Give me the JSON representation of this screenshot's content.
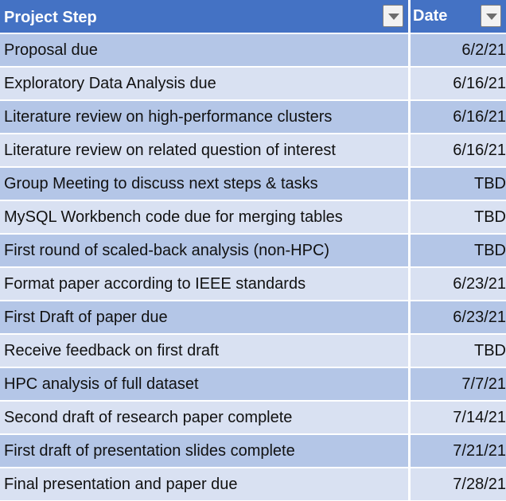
{
  "header": {
    "step_label": "Project Step",
    "date_label": "Date",
    "filter_icon": "filter-dropdown-arrow-icon"
  },
  "rows": [
    {
      "step": "Proposal due",
      "date": "6/2/21"
    },
    {
      "step": "Exploratory Data Analysis due",
      "date": "6/16/21"
    },
    {
      "step": "Literature review on high-performance clusters",
      "date": "6/16/21"
    },
    {
      "step": "Literature review on related question of interest",
      "date": "6/16/21"
    },
    {
      "step": "Group Meeting to discuss next steps & tasks",
      "date": "TBD"
    },
    {
      "step": "MySQL Workbench code due for merging tables",
      "date": "TBD"
    },
    {
      "step": "First round of scaled-back analysis (non-HPC)",
      "date": "TBD"
    },
    {
      "step": "Format paper according to IEEE standards",
      "date": "6/23/21"
    },
    {
      "step": "First Draft of paper due",
      "date": "6/23/21"
    },
    {
      "step": "Receive feedback on first draft",
      "date": "TBD"
    },
    {
      "step": "HPC analysis of full dataset",
      "date": "7/7/21"
    },
    {
      "step": "Second draft of research paper complete",
      "date": "7/14/21"
    },
    {
      "step": "First draft of presentation slides complete",
      "date": "7/21/21"
    },
    {
      "step": "Final presentation and paper due",
      "date": "7/28/21"
    }
  ],
  "colors": {
    "header": "#4472c4",
    "band_dark": "#b4c6e7",
    "band_light": "#d9e1f2"
  }
}
